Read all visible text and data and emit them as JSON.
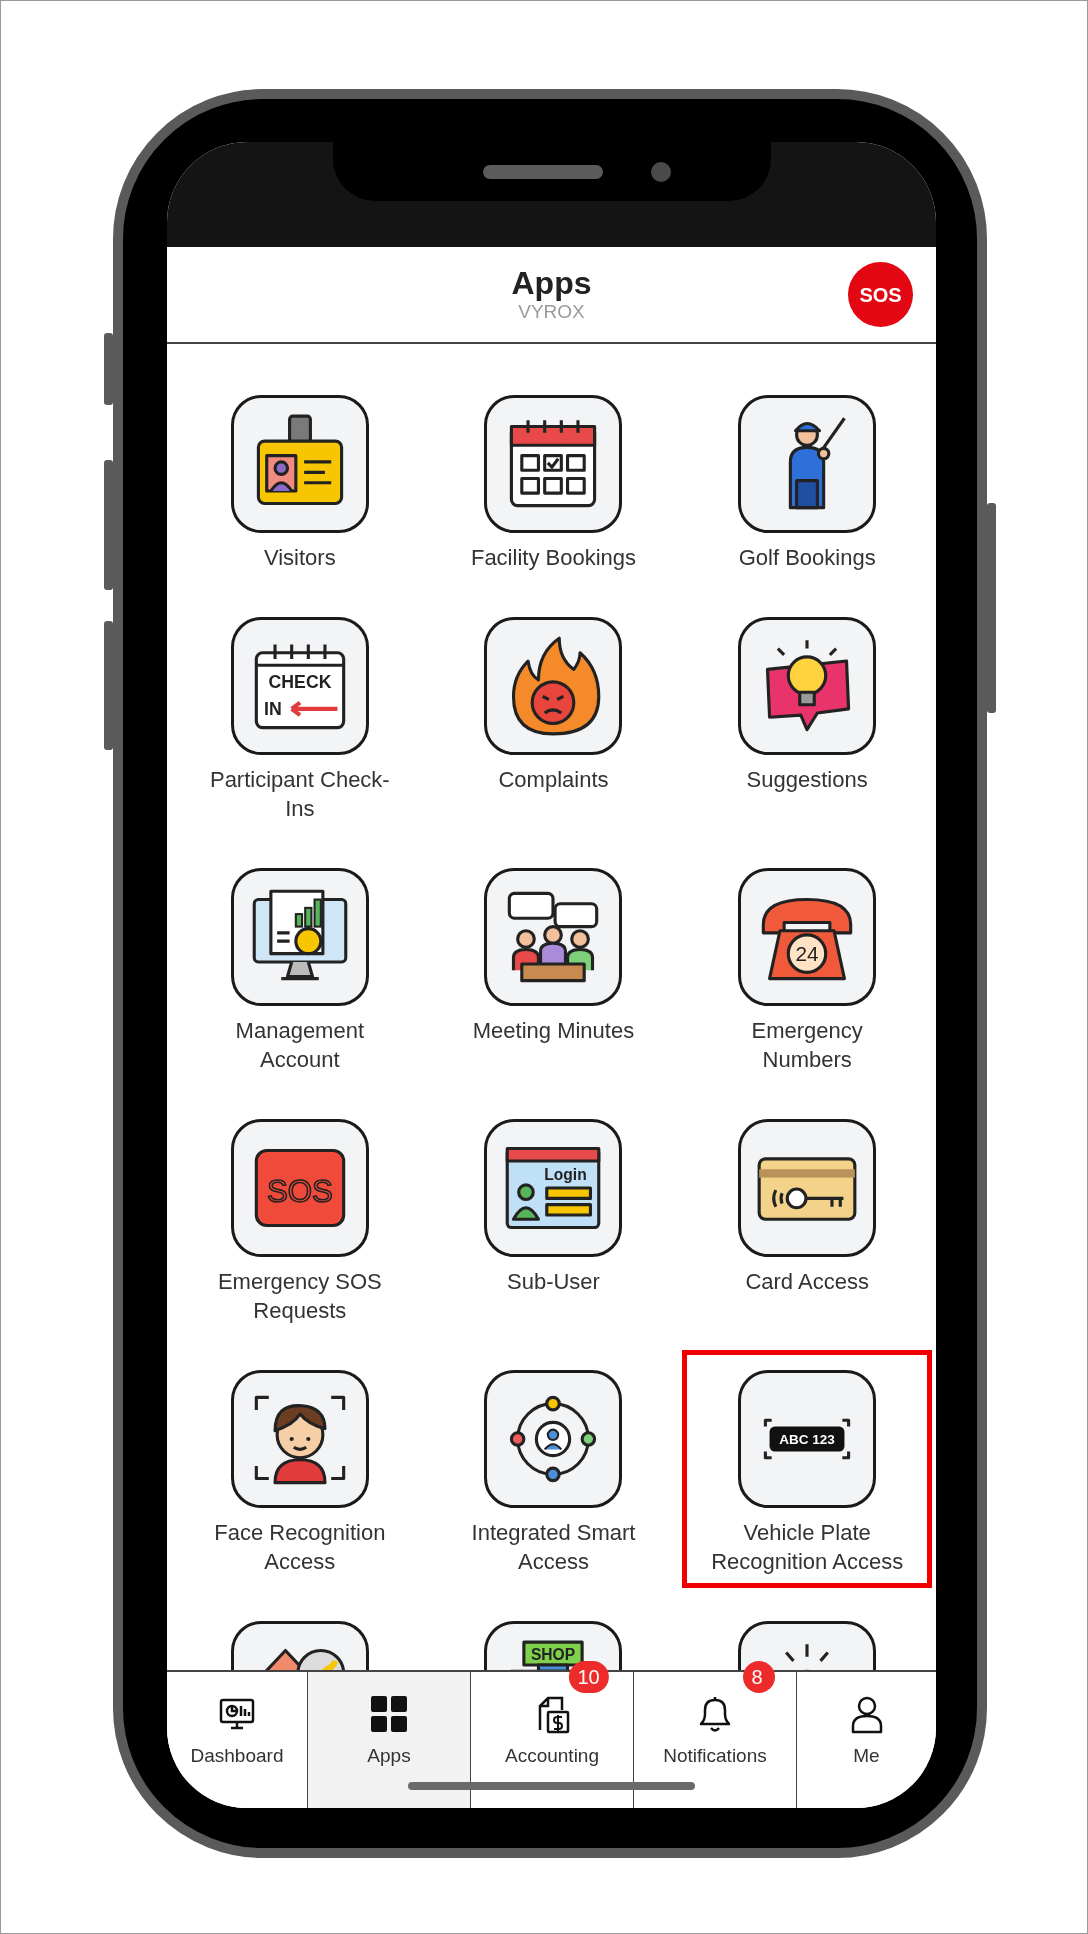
{
  "header": {
    "title": "Apps",
    "subtitle": "VYROX",
    "sos_button": "SOS"
  },
  "apps": [
    {
      "label": "Visitors",
      "highlighted": false
    },
    {
      "label": "Facility Bookings",
      "highlighted": false
    },
    {
      "label": "Golf Bookings",
      "highlighted": false
    },
    {
      "label": "Participant Check-Ins",
      "highlighted": false,
      "icon_texts": [
        "CHECK",
        "IN"
      ]
    },
    {
      "label": "Complaints",
      "highlighted": false
    },
    {
      "label": "Suggestions",
      "highlighted": false
    },
    {
      "label": "Management Account",
      "highlighted": false
    },
    {
      "label": "Meeting Minutes",
      "highlighted": false
    },
    {
      "label": "Emergency Numbers",
      "highlighted": false,
      "icon_texts": [
        "24"
      ]
    },
    {
      "label": "Emergency SOS Requests",
      "highlighted": false,
      "icon_texts": [
        "SOS"
      ]
    },
    {
      "label": "Sub-User",
      "highlighted": false,
      "icon_texts": [
        "Login"
      ]
    },
    {
      "label": "Card Access",
      "highlighted": false
    },
    {
      "label": "Face Recognition Access",
      "highlighted": false
    },
    {
      "label": "Integrated Smart Access",
      "highlighted": false
    },
    {
      "label": "Vehicle Plate Recognition Access",
      "highlighted": true,
      "icon_texts": [
        "ABC 123"
      ]
    },
    {
      "highlighted": false
    },
    {
      "highlighted": false,
      "icon_texts": [
        "SHOP"
      ]
    },
    {
      "highlighted": false
    }
  ],
  "nav": [
    {
      "label": "Dashboard",
      "selected": false
    },
    {
      "label": "Apps",
      "selected": true
    },
    {
      "label": "Accounting",
      "selected": false,
      "badge": "10"
    },
    {
      "label": "Notifications",
      "selected": false,
      "badge": "8"
    },
    {
      "label": "Me",
      "selected": false
    }
  ]
}
